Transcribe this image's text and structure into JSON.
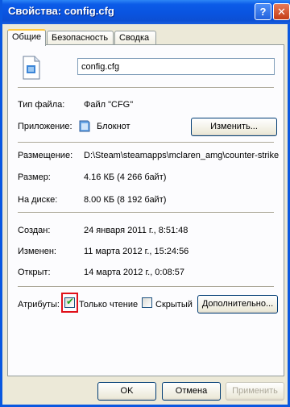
{
  "window": {
    "title": "Свойства: config.cfg"
  },
  "tabs": [
    {
      "label": "Общие"
    },
    {
      "label": "Безопасность"
    },
    {
      "label": "Сводка"
    }
  ],
  "general": {
    "file_name": "config.cfg",
    "file_type_label": "Тип файла:",
    "file_type_value": "Файл \"CFG\"",
    "app_label": "Приложение:",
    "app_value": "Блокнот",
    "change_button": "Изменить...",
    "location_label": "Размещение:",
    "location_value": "D:\\Steam\\steamapps\\mclaren_amg\\counter-strike",
    "size_label": "Размер:",
    "size_value": "4.16 КБ (4 266 байт)",
    "disk_label": "На диске:",
    "disk_value": "8.00 КБ (8 192 байт)",
    "created_label": "Создан:",
    "created_value": "24 января 2011 г., 8:51:48",
    "modified_label": "Изменен:",
    "modified_value": "11 марта 2012 г., 15:24:56",
    "accessed_label": "Открыт:",
    "accessed_value": "14 марта 2012 г., 0:08:57",
    "attributes_label": "Атрибуты:",
    "readonly_label": "Только чтение",
    "readonly_checked": true,
    "hidden_label": "Скрытый",
    "hidden_checked": false,
    "advanced_button": "Дополнительно..."
  },
  "footer": {
    "ok": "OK",
    "cancel": "Отмена",
    "apply": "Применить"
  },
  "colors": {
    "titlebar": "#0a54e0",
    "highlight": "#e0101a",
    "check": "#21a121"
  },
  "icons": [
    "help-icon",
    "close-icon",
    "file-icon",
    "notepad-icon",
    "checkmark-icon"
  ]
}
